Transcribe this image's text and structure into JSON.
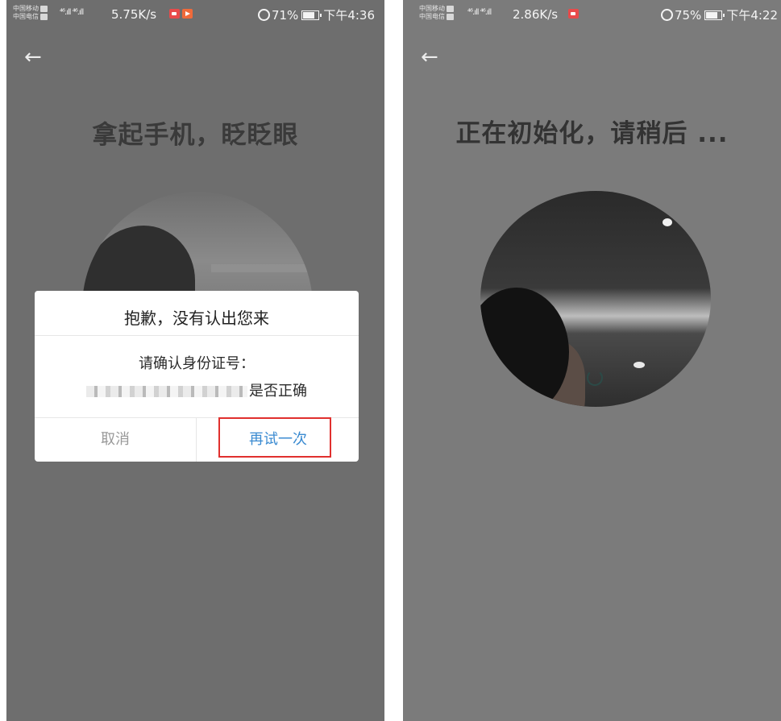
{
  "left_screen": {
    "status": {
      "carrier1": "中国移动",
      "carrier2": "中国电信",
      "signal": "⁴⁶.ıll ⁴⁶.ıll",
      "speed": "5.75K/s",
      "battery": "71%",
      "time": "下午4:36"
    },
    "title": "拿起手机，眨眨眼",
    "dialog": {
      "title": "抱歉，没有认出您来",
      "message_line1": "请确认身份证号：",
      "message_suffix": "是否正确",
      "cancel_label": "取消",
      "retry_label": "再试一次"
    }
  },
  "right_screen": {
    "status": {
      "carrier1": "中国移动",
      "carrier2": "中国电信",
      "signal": "⁴⁶.ıll ⁴⁶.ıll",
      "speed": "2.86K/s",
      "battery": "75%",
      "time": "下午4:22"
    },
    "title": "正在初始化，请稍后 ..."
  },
  "icons": [
    "back-arrow-icon",
    "alarm-icon",
    "battery-icon",
    "record-icon",
    "play-icon",
    "loading-spinner-icon"
  ],
  "colors": {
    "retry_blue": "#3b8bd1",
    "highlight_red": "#e0302e",
    "overlay_gray": "#6e6e6e"
  }
}
